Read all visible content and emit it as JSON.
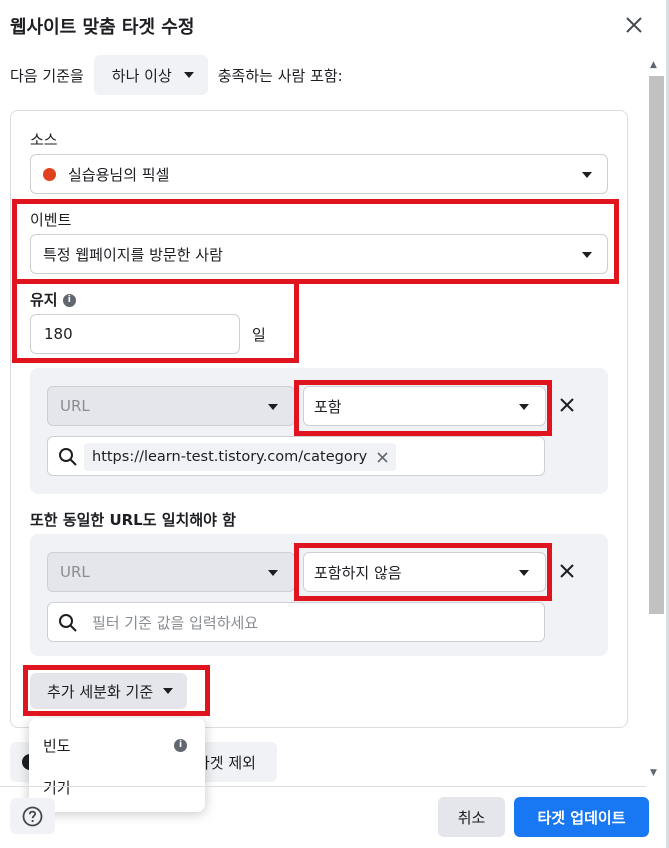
{
  "dialog": {
    "title": "웹사이트 맞춤 타겟 수정"
  },
  "criteria": {
    "prefix": "다음 기준을",
    "match_select": "하나 이상",
    "suffix": "충족하는 사람 포함:"
  },
  "source": {
    "label": "소스",
    "value": "실습용님의 픽셀",
    "dot_color": "#e0411f"
  },
  "event": {
    "label": "이벤트",
    "value": "특정 웹페이지를 방문한 사람"
  },
  "retention": {
    "label": "유지",
    "value": "180",
    "unit": "일"
  },
  "rule1": {
    "field": "URL",
    "operator": "포함",
    "token": "https://learn-test.tistory.com/category"
  },
  "also_match": {
    "label": "또한 동일한 URL도 일치해야 함"
  },
  "rule2": {
    "field": "URL",
    "operator": "포함하지 않음",
    "placeholder": "필터 기준 값을 입력하세요"
  },
  "refine": {
    "label": "추가 세분화 기준"
  },
  "refine_menu": {
    "items": [
      {
        "label": "빈도"
      },
      {
        "label": "기기"
      }
    ]
  },
  "exclude": {
    "label": "타겟 제외"
  },
  "footer": {
    "cancel": "취소",
    "update": "타겟 업데이트"
  },
  "colors": {
    "highlight": "#e0141e",
    "primary": "#1877f2"
  }
}
